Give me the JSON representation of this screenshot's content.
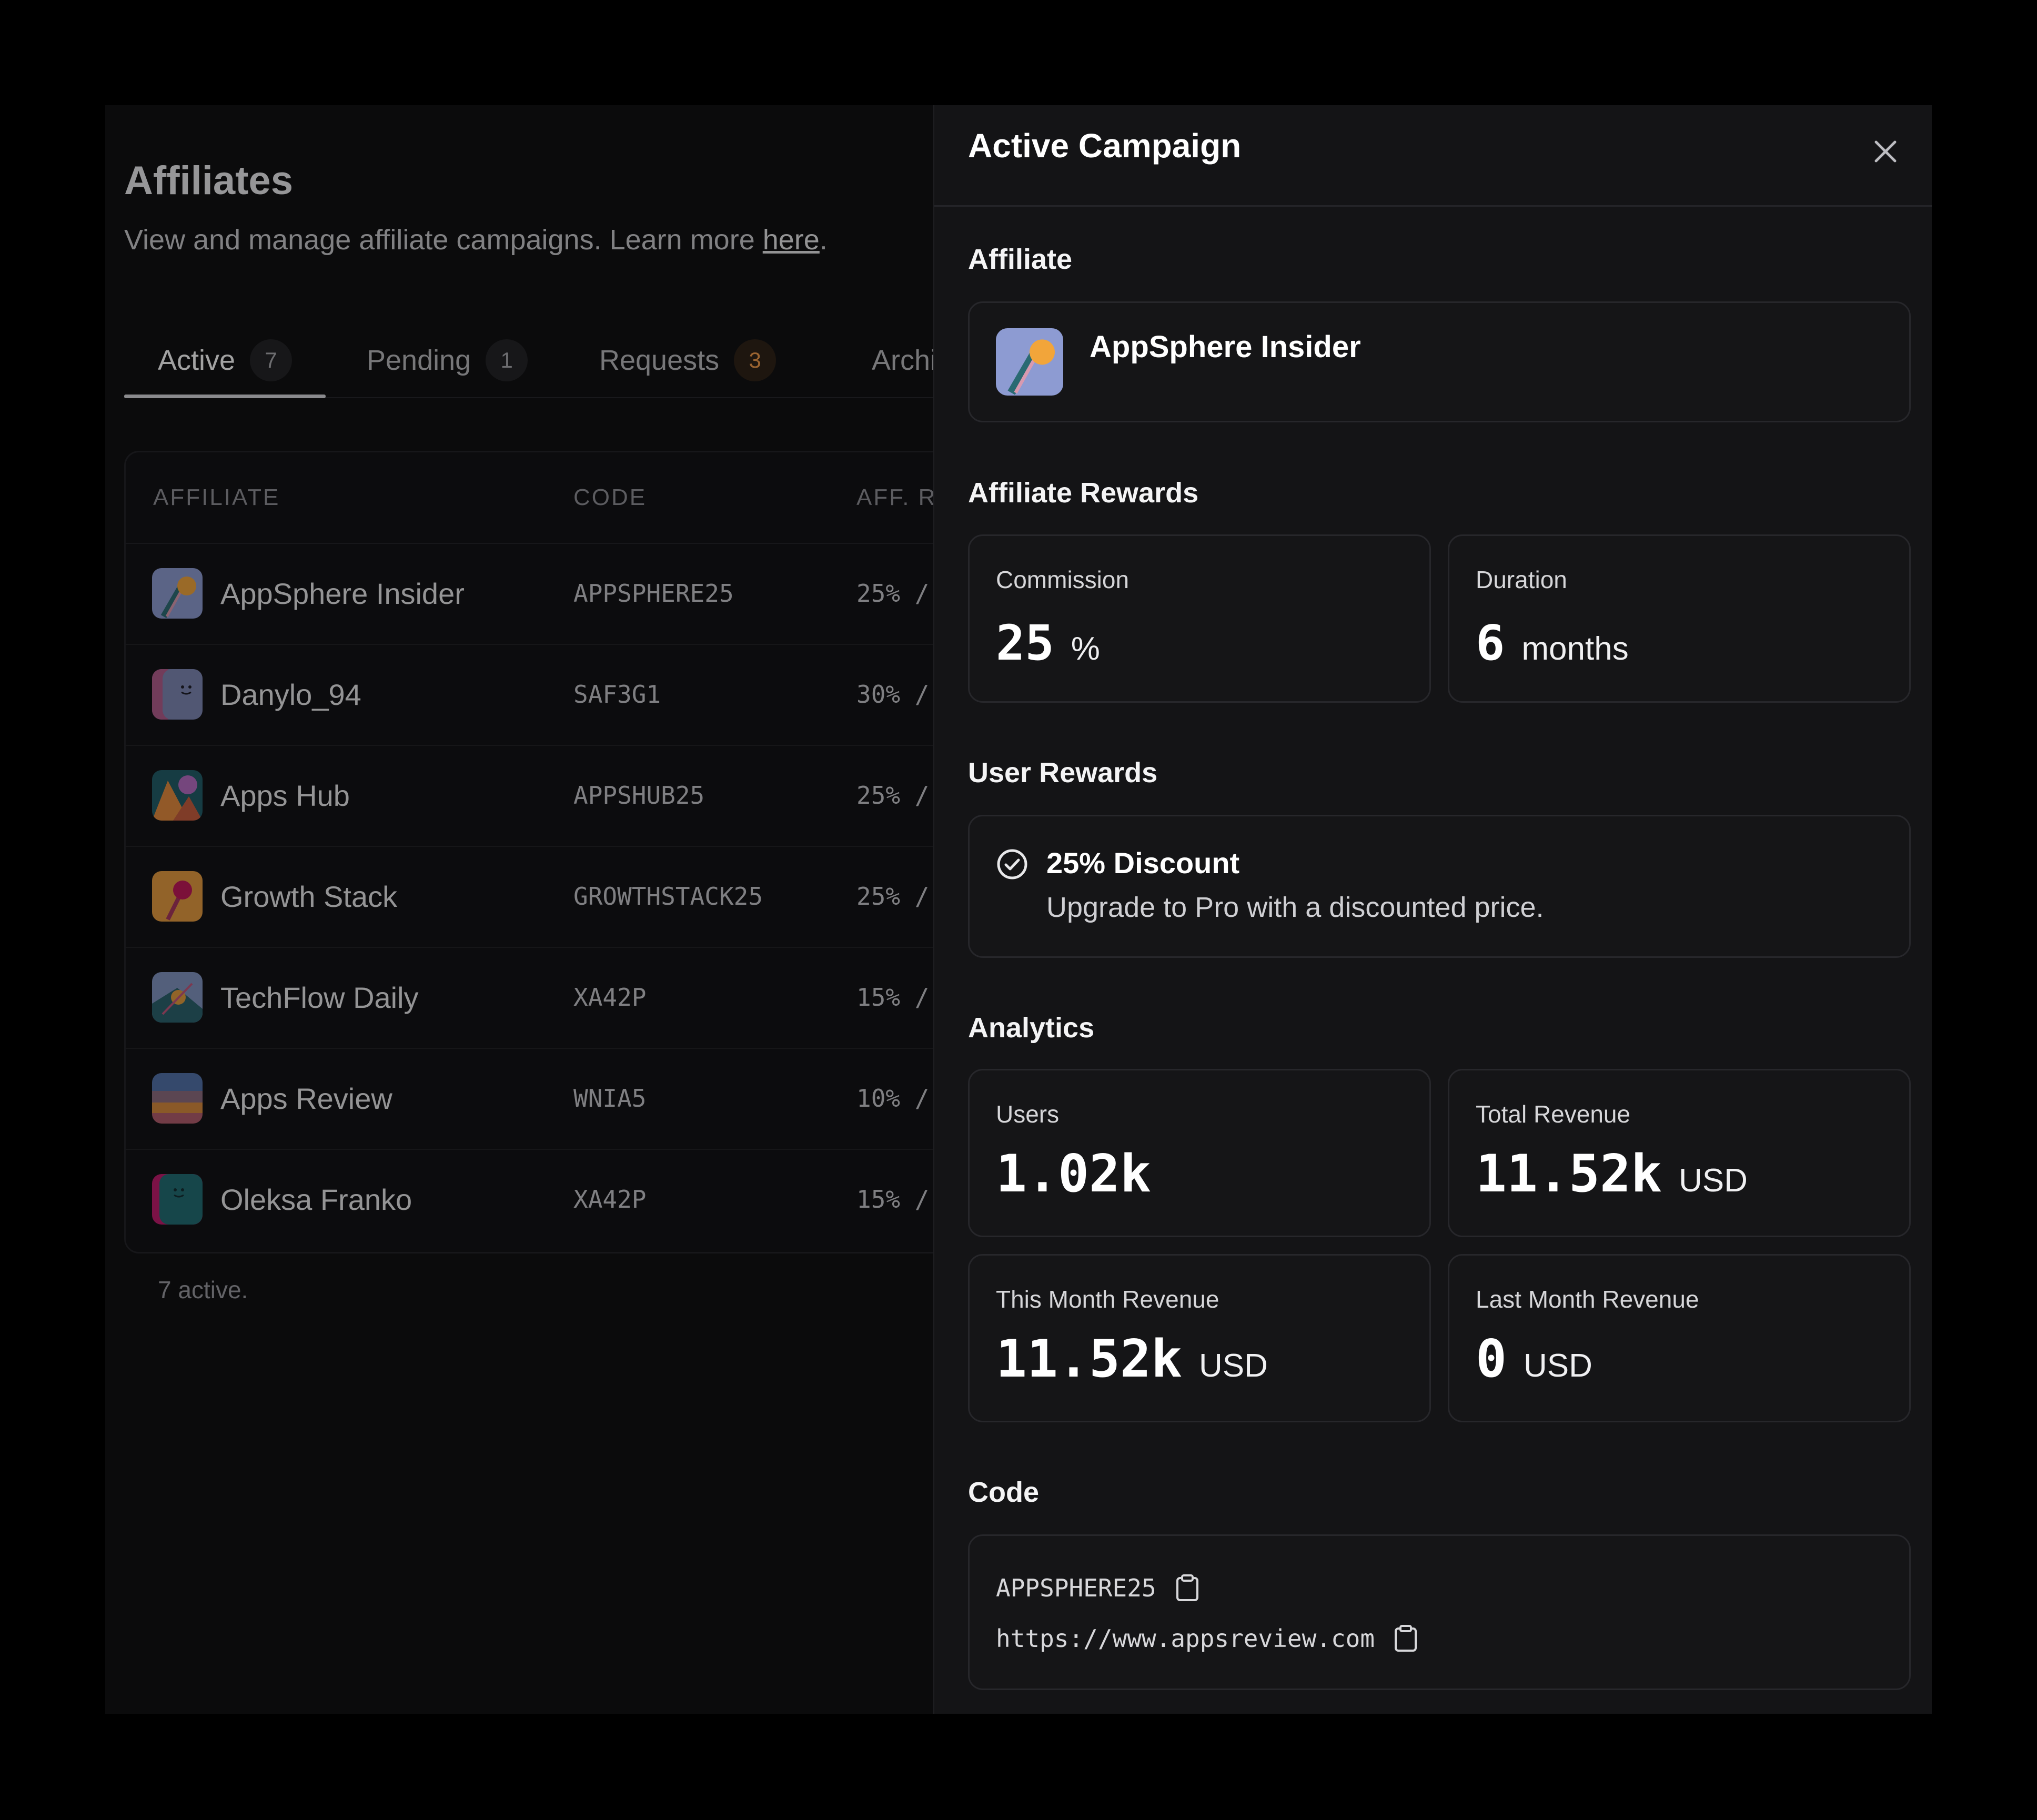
{
  "page": {
    "title": "Affiliates",
    "subtitle": "View and manage affiliate campaigns. Learn more ",
    "link_text": "here",
    "subtitle_end": "."
  },
  "tabs": [
    {
      "label": "Active",
      "count": "7"
    },
    {
      "label": "Pending",
      "count": "1"
    },
    {
      "label": "Requests",
      "count": "3"
    },
    {
      "label": "Archiv",
      "count": ""
    }
  ],
  "table": {
    "headers": [
      "AFFILIATE",
      "CODE",
      "AFF. R"
    ],
    "rows": [
      {
        "name": "AppSphere Insider",
        "code": "APPSPHERE25",
        "rate": "25% /"
      },
      {
        "name": "Danylo_94",
        "code": "SAF3G1",
        "rate": "30% /"
      },
      {
        "name": "Apps Hub",
        "code": "APPSHUB25",
        "rate": "25% /"
      },
      {
        "name": "Growth Stack",
        "code": "GROWTHSTACK25",
        "rate": "25% /"
      },
      {
        "name": "TechFlow Daily",
        "code": "XA42P",
        "rate": "15% /"
      },
      {
        "name": "Apps Review",
        "code": "WNIA5",
        "rate": "10% /"
      },
      {
        "name": "Oleksa Franko",
        "code": "XA42P",
        "rate": "15% /"
      }
    ],
    "footnote": "7 active."
  },
  "panel": {
    "title": "Active Campaign",
    "affiliate_label": "Affiliate",
    "affiliate_name": "AppSphere Insider",
    "affiliate_rewards_label": "Affiliate Rewards",
    "commission": {
      "label": "Commission",
      "value": "25",
      "unit": "%"
    },
    "duration": {
      "label": "Duration",
      "value": "6",
      "unit": "months"
    },
    "user_rewards_label": "User Rewards",
    "discount": {
      "title": "25% Discount",
      "description": "Upgrade to Pro with a discounted price."
    },
    "analytics_label": "Analytics",
    "users": {
      "label": "Users",
      "value": "1.02k"
    },
    "total_revenue": {
      "label": "Total Revenue",
      "value": "11.52k",
      "unit": "USD"
    },
    "this_month_revenue": {
      "label": "This Month Revenue",
      "value": "11.52k",
      "unit": "USD"
    },
    "last_month_revenue": {
      "label": "Last Month Revenue",
      "value": "0",
      "unit": "USD"
    },
    "code_label": "Code",
    "code_value": "APPSPHERE25",
    "url_value": "https://www.appsreview.com"
  },
  "icons": {
    "close": "close-icon",
    "check_circle": "check-circle-icon",
    "copy": "clipboard-icon"
  },
  "colors": {
    "background": "#000000",
    "window": "#0b0b0c",
    "panel": "#141416",
    "accent_orange": "#f29a47"
  }
}
